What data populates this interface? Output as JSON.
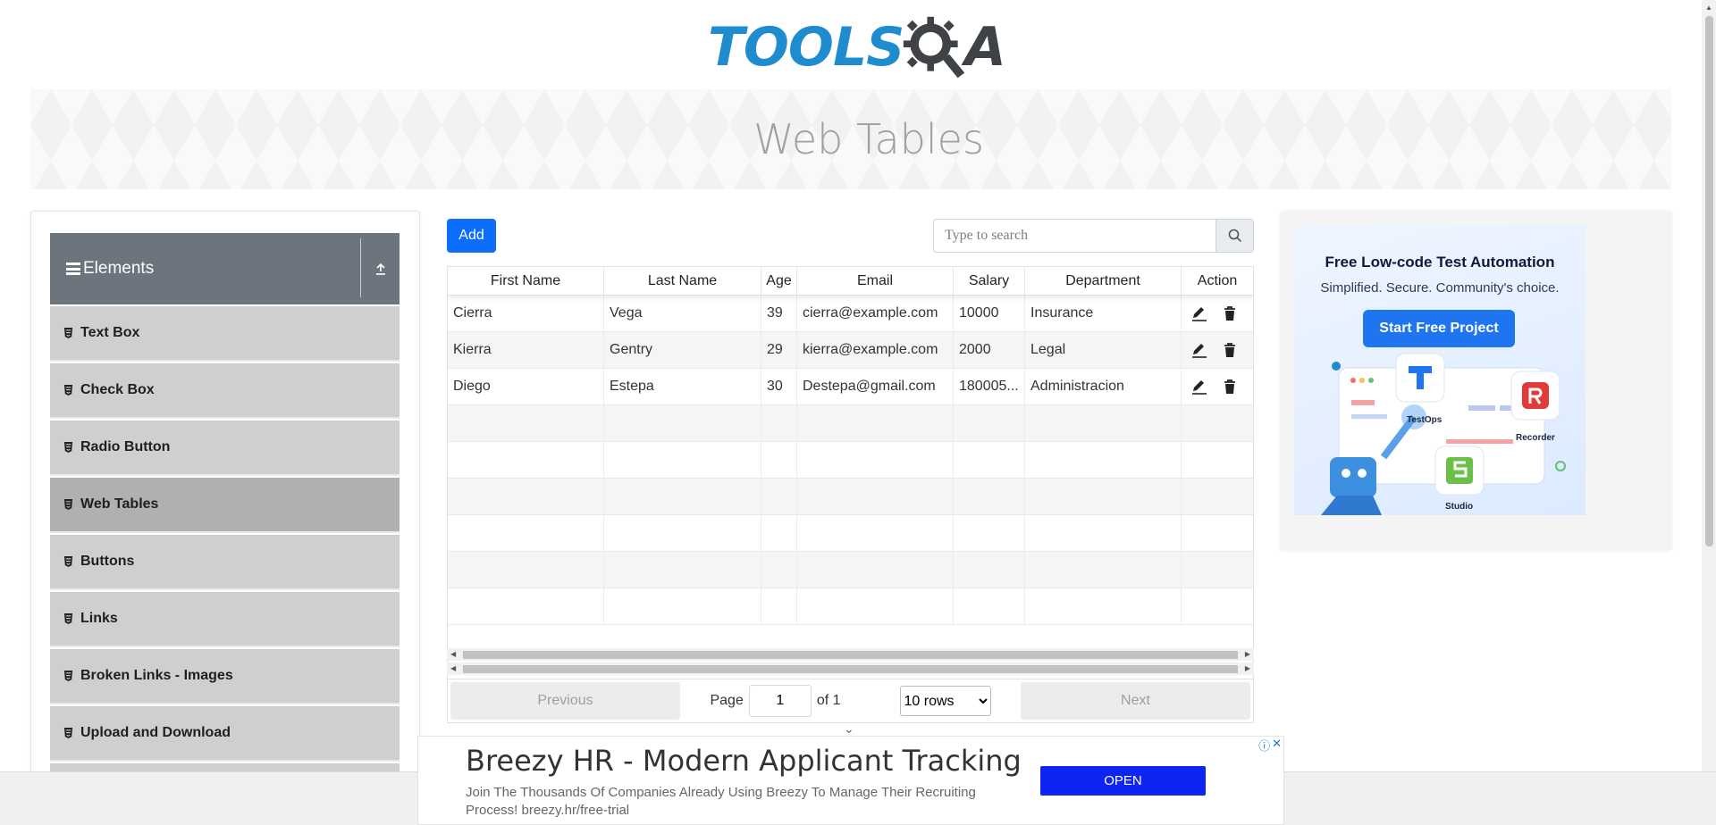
{
  "logo": {
    "part1": "TOOLS",
    "part2": "A"
  },
  "banner": {
    "title": "Web Tables"
  },
  "sidebar": {
    "group_title": "Elements",
    "items": [
      {
        "label": "Text Box"
      },
      {
        "label": "Check Box"
      },
      {
        "label": "Radio Button"
      },
      {
        "label": "Web Tables",
        "active": true
      },
      {
        "label": "Buttons"
      },
      {
        "label": "Links"
      },
      {
        "label": "Broken Links - Images"
      },
      {
        "label": "Upload and Download"
      }
    ]
  },
  "toolbar": {
    "add_label": "Add",
    "search_placeholder": "Type to search"
  },
  "table": {
    "headers": [
      "First Name",
      "Last Name",
      "Age",
      "Email",
      "Salary",
      "Department",
      "Action"
    ],
    "rows": [
      [
        "Cierra",
        "Vega",
        "39",
        "cierra@example.com",
        "10000",
        "Insurance"
      ],
      [
        "Kierra",
        "Gentry",
        "29",
        "kierra@example.com",
        "2000",
        "Legal"
      ],
      [
        "Diego",
        "Estepa",
        "30",
        "Destepa@gmail.com",
        "180005...",
        "Administracion"
      ]
    ]
  },
  "pagination": {
    "previous": "Previous",
    "page_label": "Page",
    "page_value": "1",
    "of_label": "of 1",
    "rows_option": "10 rows",
    "next": "Next"
  },
  "side_ad": {
    "title": "Free Low-code Test Automation",
    "subtitle": "Simplified. Secure. Community's choice.",
    "cta": "Start Free Project",
    "labels": [
      "TestOps",
      "Recorder",
      "Studio"
    ]
  },
  "bottom_ad": {
    "title": "Breezy HR - Modern Applicant Tracking",
    "description": "Join The Thousands Of Companies Already Using Breezy To Manage Their Recruiting Process! breezy.hr/free-trial",
    "cta": "OPEN"
  },
  "colors": {
    "primary": "#0d6efd",
    "sidebar_header": "#6c757d",
    "menu_item": "#cfcfcf",
    "menu_active": "#b0b0b0",
    "logo_blue": "#1f8cd0"
  }
}
